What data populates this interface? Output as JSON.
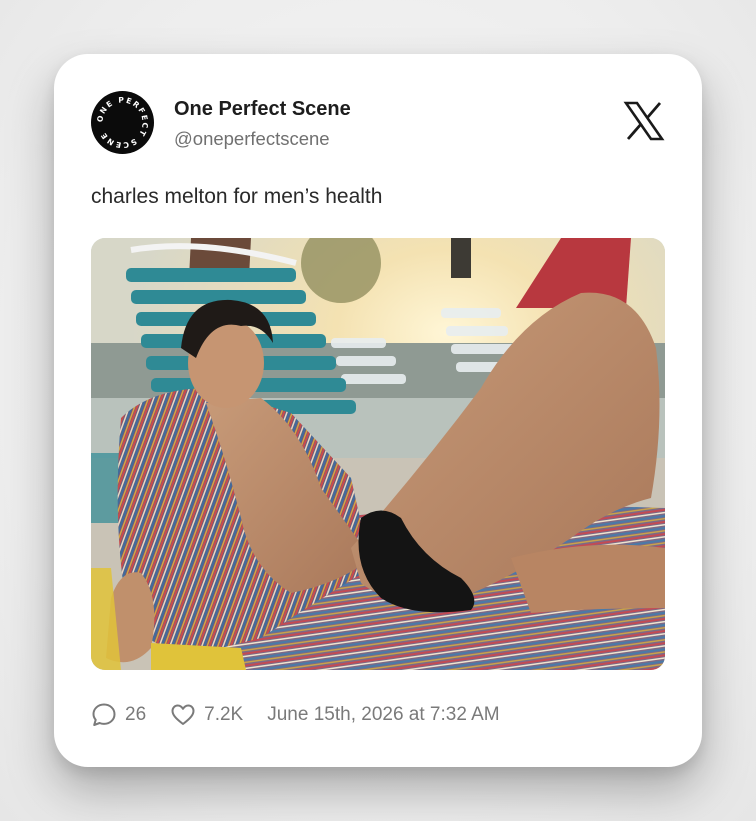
{
  "post": {
    "display_name": "One Perfect Scene",
    "handle": "@oneperfectscene",
    "avatar_text": "ONE PERFECT SCENE",
    "text": "charles melton for men’s health",
    "media_icon": "photo",
    "platform_icon": "x-logo-icon"
  },
  "stats": {
    "replies": "26",
    "likes": "7.2K",
    "timestamp": "June 15th, 2026 at 7:32 AM",
    "reply_icon": "comment-bubble-icon",
    "like_icon": "heart-icon"
  },
  "colors": {
    "card_bg": "#ffffff",
    "page_bg": "#efefef",
    "name_text": "#1d1d1d",
    "muted_text": "#707070"
  }
}
